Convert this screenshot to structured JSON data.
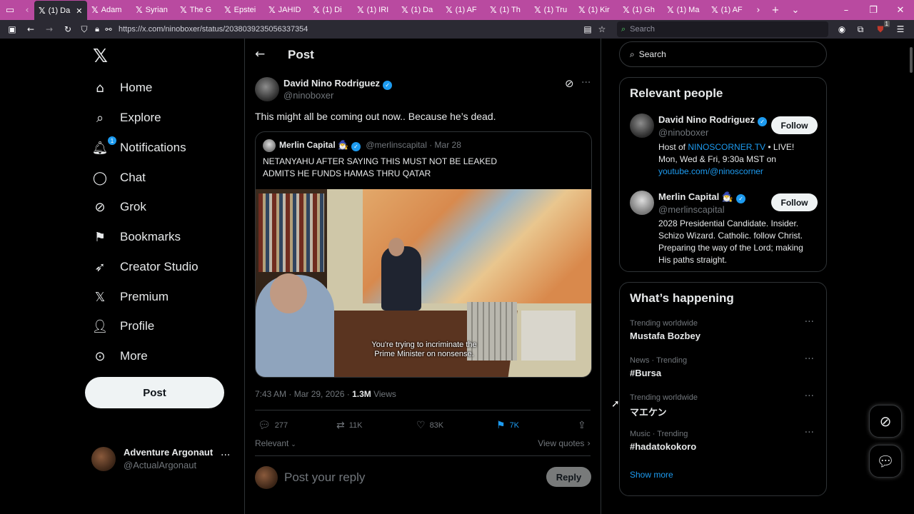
{
  "browser": {
    "tabs": [
      "(1) Da",
      "Adam",
      "Syrian",
      "The G",
      "Epstei",
      "JAHID",
      "(1) Di",
      "(1) IRI",
      "(1) Da",
      "(1) AF",
      "(1) Th",
      "(1) Tru",
      "(1) Kir",
      "(1) Gh",
      "(1) Ma",
      "(1) AF"
    ],
    "url": "https://x.com/ninoboxer/status/2038039235056337354",
    "search_placeholder": "Search",
    "extension_badge": "1"
  },
  "leftnav": {
    "items": [
      {
        "label": "Home",
        "icon": "home-icon"
      },
      {
        "label": "Explore",
        "icon": "search-icon"
      },
      {
        "label": "Notifications",
        "icon": "bell-icon",
        "badge": "1"
      },
      {
        "label": "Chat",
        "icon": "chat-icon"
      },
      {
        "label": "Grok",
        "icon": "grok-icon"
      },
      {
        "label": "Bookmarks",
        "icon": "bookmark-icon"
      },
      {
        "label": "Creator Studio",
        "icon": "rocket-icon"
      },
      {
        "label": "Premium",
        "icon": "x-logo-icon"
      },
      {
        "label": "Profile",
        "icon": "person-icon"
      },
      {
        "label": "More",
        "icon": "more-circle-icon"
      }
    ],
    "post_label": "Post",
    "account": {
      "name": "Adventure Argonaut",
      "handle": "@ActualArgonaut"
    }
  },
  "header": {
    "title": "Post"
  },
  "post": {
    "author_name": "David Nino Rodriguez",
    "author_handle": "@ninoboxer",
    "text": "This might all be coming out now.. Because he’s dead.",
    "quote": {
      "author_name": "Merlin Capital 🧙‍♂️",
      "author_handle": "@merlinscapital",
      "date": "Mar 28",
      "text_line1": "NETANYAHU AFTER SAYING THIS MUST NOT BE LEAKED",
      "text_line2": "ADMITS HE FUNDS HAMAS THRU QATAR",
      "subtitle_line1": "You're trying to incriminate the",
      "subtitle_line2": "Prime Minister on nonsense."
    },
    "timestamp": "7:43 AM · Mar 29, 2026 · ",
    "views_count": "1.3M",
    "views_label": " Views",
    "replies": "277",
    "reposts": "11K",
    "likes": "83K",
    "bookmarks": "7K",
    "sort_label": "Relevant",
    "view_quotes": "View quotes",
    "reply_placeholder": "Post your reply",
    "reply_button": "Reply"
  },
  "right": {
    "search_placeholder": "Search",
    "relevant_title": "Relevant people",
    "people": [
      {
        "name": "David Nino Rodriguez",
        "handle": "@ninoboxer",
        "follow": "Follow",
        "bio_a": "Host of ",
        "bio_link": "NINOSCORNER.TV",
        "bio_b": " • LIVE!",
        "bio_c": "Mon, Wed & Fri, 9:30a MST on",
        "bio_link2": "youtube.com/@ninoscorner"
      },
      {
        "name": "Merlin Capital 🧙‍♂️",
        "handle": "@merlinscapital",
        "follow": "Follow",
        "bio_1": "2028 Presidential Candidate. Insider.",
        "bio_2": "Schizo Wizard. Catholic. follow Christ.",
        "bio_3": "Preparing the way of the Lord; making",
        "bio_4": "His paths straight."
      }
    ],
    "happening_title": "What’s happening",
    "trends": [
      {
        "context": "Trending worldwide",
        "topic": "Mustafa Bozbey"
      },
      {
        "context": "News · Trending",
        "topic": "#Bursa"
      },
      {
        "context": "Trending worldwide",
        "topic": "マエケン"
      },
      {
        "context": "Music · Trending",
        "topic": "#hadatokokoro"
      }
    ],
    "show_more": "Show more"
  },
  "colors": {
    "accent": "#1d9bf0",
    "tabbar": "#b94aa0",
    "background": "#000000"
  }
}
